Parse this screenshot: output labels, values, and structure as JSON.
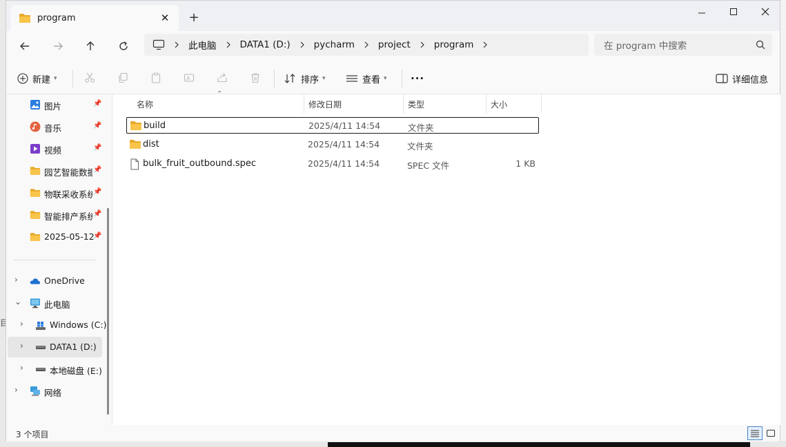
{
  "window": {
    "tab_title": "program",
    "close_tab": "✕",
    "new_tab": "+"
  },
  "address": {
    "segments": [
      "此电脑",
      "DATA1 (D:)",
      "pycharm",
      "project",
      "program"
    ]
  },
  "search": {
    "placeholder": "在 program 中搜索"
  },
  "toolbar": {
    "new_label": "新建",
    "sort_label": "排序",
    "view_label": "查看",
    "more_label": "···",
    "details_label": "详细信息"
  },
  "sidebar": {
    "quick_access": [
      {
        "label": "图片",
        "icon": "pictures-icon"
      },
      {
        "label": "音乐",
        "icon": "music-icon"
      },
      {
        "label": "视频",
        "icon": "videos-icon"
      },
      {
        "label": "园艺智能数据",
        "icon": "folder-icon"
      },
      {
        "label": "物联采收系统",
        "icon": "folder-icon"
      },
      {
        "label": "智能排产系统",
        "icon": "folder-icon"
      },
      {
        "label": "2025-05-12",
        "icon": "folder-icon"
      }
    ],
    "tree": [
      {
        "label": "OneDrive",
        "icon": "onedrive-icon",
        "expanded": false
      },
      {
        "label": "此电脑",
        "icon": "this-pc-icon",
        "expanded": true
      },
      {
        "label": "Windows (C:)",
        "icon": "windows-drive-icon",
        "expanded": false
      },
      {
        "label": "DATA1 (D:)",
        "icon": "drive-icon",
        "expanded": false,
        "selected": true
      },
      {
        "label": "本地磁盘 (E:)",
        "icon": "drive-icon",
        "expanded": false
      },
      {
        "label": "网络",
        "icon": "network-icon",
        "expanded": false
      }
    ]
  },
  "columns": {
    "name": "名称",
    "date": "修改日期",
    "type": "类型",
    "size": "大小"
  },
  "files": [
    {
      "name": "build",
      "date": "2025/4/11 14:54",
      "type": "文件夹",
      "size": "",
      "icon": "folder-icon",
      "selected": true
    },
    {
      "name": "dist",
      "date": "2025/4/11 14:54",
      "type": "文件夹",
      "size": "",
      "icon": "folder-icon"
    },
    {
      "name": "bulk_fruit_outbound.spec",
      "date": "2025/4/11 14:54",
      "type": "SPEC 文件",
      "size": "1 KB",
      "icon": "file-icon"
    }
  ],
  "status": {
    "item_count": "3 个项目"
  },
  "background": {
    "stray_text": "目"
  },
  "colors": {
    "folder": "#f8c44a",
    "folder_dark": "#e8a92a",
    "accent": "#4a86c7",
    "onedrive": "#1f6fd1"
  }
}
